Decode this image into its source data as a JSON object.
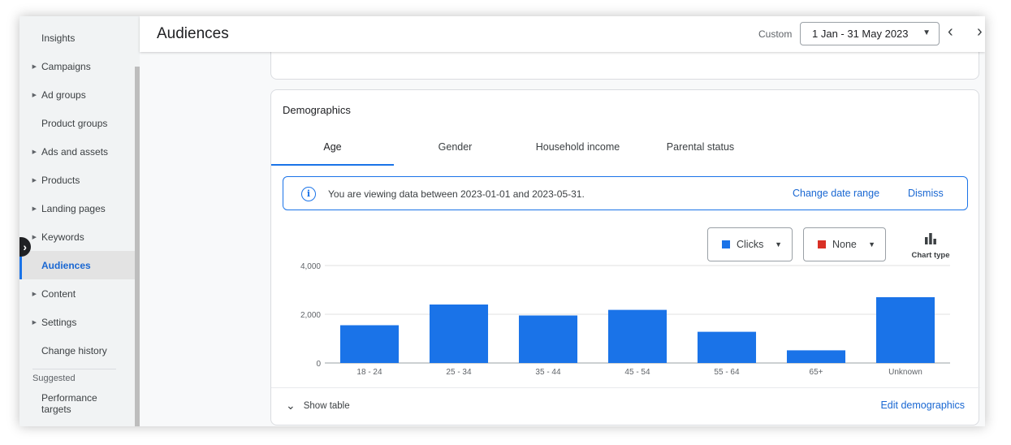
{
  "sidebar": {
    "items": [
      {
        "label": "Insights",
        "expandable": false,
        "active": false
      },
      {
        "label": "Campaigns",
        "expandable": true,
        "active": false
      },
      {
        "label": "Ad groups",
        "expandable": true,
        "active": false
      },
      {
        "label": "Product groups",
        "expandable": false,
        "active": false
      },
      {
        "label": "Ads and assets",
        "expandable": true,
        "active": false
      },
      {
        "label": "Products",
        "expandable": true,
        "active": false
      },
      {
        "label": "Landing pages",
        "expandable": true,
        "active": false
      },
      {
        "label": "Keywords",
        "expandable": true,
        "active": false
      },
      {
        "label": "Audiences",
        "expandable": false,
        "active": true
      },
      {
        "label": "Content",
        "expandable": true,
        "active": false
      },
      {
        "label": "Settings",
        "expandable": true,
        "active": false
      },
      {
        "label": "Change history",
        "expandable": false,
        "active": false
      }
    ],
    "suggested_label": "Suggested",
    "performance_targets": "Performance targets"
  },
  "header": {
    "title": "Audiences",
    "date_mode": "Custom",
    "date_range": "1 Jan - 31 May 2023"
  },
  "card": {
    "title": "Demographics",
    "tabs": [
      "Age",
      "Gender",
      "Household income",
      "Parental status"
    ],
    "active_tab": "Age",
    "info": {
      "text": "You are viewing data between 2023-01-01 and 2023-05-31.",
      "change_link": "Change date range",
      "dismiss_link": "Dismiss"
    },
    "metric1": {
      "label": "Clicks",
      "color": "#1a73e8"
    },
    "metric2": {
      "label": "None",
      "color": "#d93025"
    },
    "chart_type_label": "Chart type",
    "show_table": "Show table",
    "edit_link": "Edit demographics"
  },
  "chart_data": {
    "type": "bar",
    "categories": [
      "18 - 24",
      "25 - 34",
      "35 - 44",
      "45 - 54",
      "55 - 64",
      "65+",
      "Unknown"
    ],
    "values": [
      1550,
      2400,
      1950,
      2180,
      1280,
      520,
      2700
    ],
    "ylim": [
      0,
      4000
    ],
    "yticks": [
      0,
      2000,
      4000
    ],
    "ytick_labels": [
      "0",
      "2,000",
      "4,000"
    ],
    "grid": true,
    "color": "#1a73e8"
  }
}
